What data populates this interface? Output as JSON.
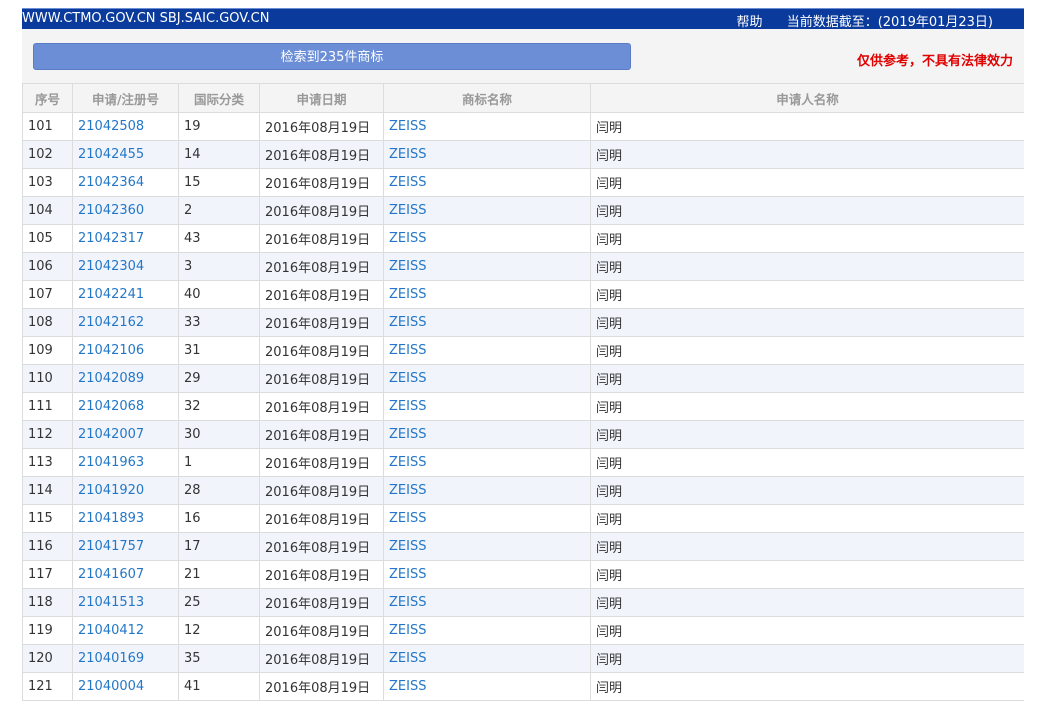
{
  "header": {
    "sites": "WWW.CTMO.GOV.CN SBJ.SAIC.GOV.CN",
    "help": "帮助",
    "date_label": "当前数据截至：(2019年01月23日)"
  },
  "toolbar": {
    "result_label": "检索到235件商标",
    "disclaimer": "仅供参考，不具有法律效力"
  },
  "table": {
    "columns": [
      "序号",
      "申请/注册号",
      "国际分类",
      "申请日期",
      "商标名称",
      "申请人名称"
    ],
    "rows": [
      [
        "101",
        "21042508",
        "19",
        "2016年08月19日",
        "ZEISS",
        "闫明"
      ],
      [
        "102",
        "21042455",
        "14",
        "2016年08月19日",
        "ZEISS",
        "闫明"
      ],
      [
        "103",
        "21042364",
        "15",
        "2016年08月19日",
        "ZEISS",
        "闫明"
      ],
      [
        "104",
        "21042360",
        "2",
        "2016年08月19日",
        "ZEISS",
        "闫明"
      ],
      [
        "105",
        "21042317",
        "43",
        "2016年08月19日",
        "ZEISS",
        "闫明"
      ],
      [
        "106",
        "21042304",
        "3",
        "2016年08月19日",
        "ZEISS",
        "闫明"
      ],
      [
        "107",
        "21042241",
        "40",
        "2016年08月19日",
        "ZEISS",
        "闫明"
      ],
      [
        "108",
        "21042162",
        "33",
        "2016年08月19日",
        "ZEISS",
        "闫明"
      ],
      [
        "109",
        "21042106",
        "31",
        "2016年08月19日",
        "ZEISS",
        "闫明"
      ],
      [
        "110",
        "21042089",
        "29",
        "2016年08月19日",
        "ZEISS",
        "闫明"
      ],
      [
        "111",
        "21042068",
        "32",
        "2016年08月19日",
        "ZEISS",
        "闫明"
      ],
      [
        "112",
        "21042007",
        "30",
        "2016年08月19日",
        "ZEISS",
        "闫明"
      ],
      [
        "113",
        "21041963",
        "1",
        "2016年08月19日",
        "ZEISS",
        "闫明"
      ],
      [
        "114",
        "21041920",
        "28",
        "2016年08月19日",
        "ZEISS",
        "闫明"
      ],
      [
        "115",
        "21041893",
        "16",
        "2016年08月19日",
        "ZEISS",
        "闫明"
      ],
      [
        "116",
        "21041757",
        "17",
        "2016年08月19日",
        "ZEISS",
        "闫明"
      ],
      [
        "117",
        "21041607",
        "21",
        "2016年08月19日",
        "ZEISS",
        "闫明"
      ],
      [
        "118",
        "21041513",
        "25",
        "2016年08月19日",
        "ZEISS",
        "闫明"
      ],
      [
        "119",
        "21040412",
        "12",
        "2016年08月19日",
        "ZEISS",
        "闫明"
      ],
      [
        "120",
        "21040169",
        "35",
        "2016年08月19日",
        "ZEISS",
        "闫明"
      ],
      [
        "121",
        "21040004",
        "41",
        "2016年08月19日",
        "ZEISS",
        "闫明"
      ]
    ]
  },
  "colors": {
    "topbar": "#0a3a9c",
    "button": "#6b8ed7",
    "link": "#2477c8",
    "disclaimer": "#e00000",
    "row_alt": "#f1f5fb"
  }
}
